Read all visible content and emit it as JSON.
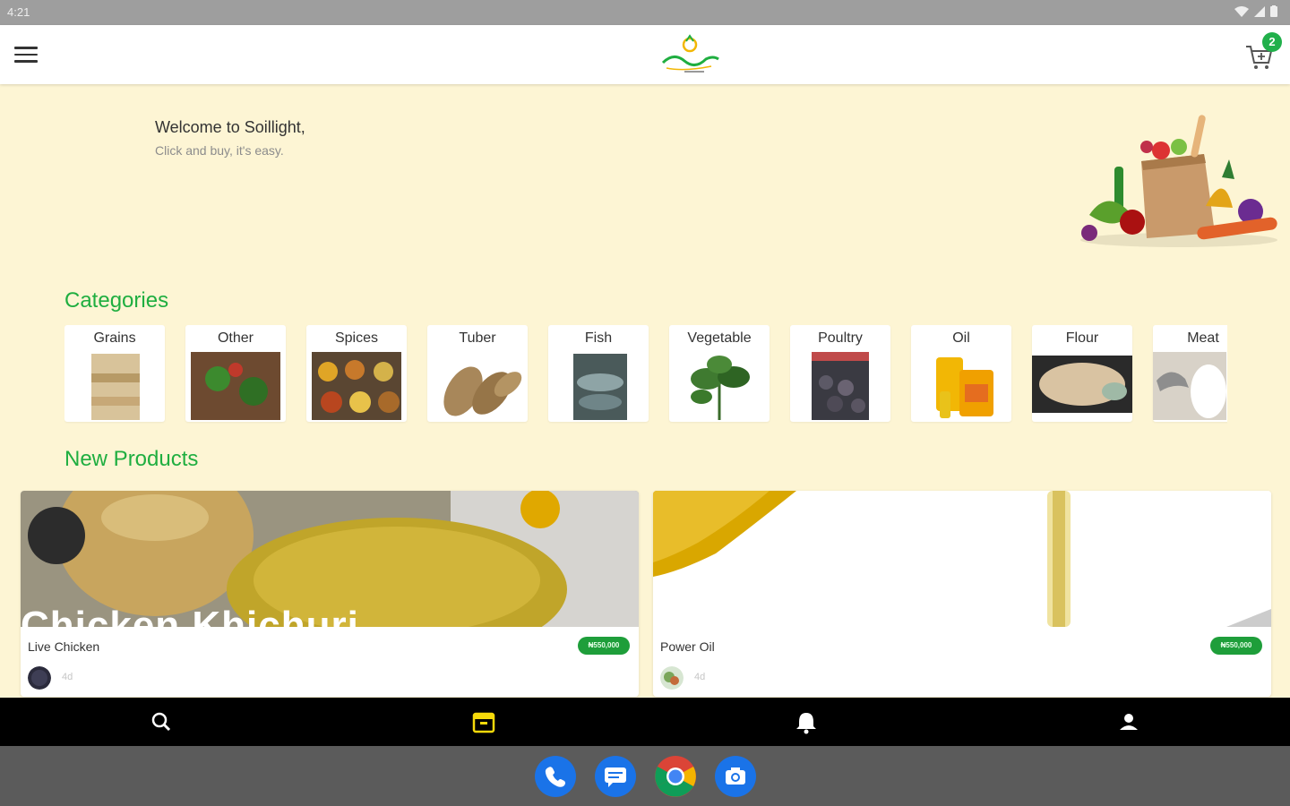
{
  "status": {
    "time": "4:21"
  },
  "app": {
    "cart_count": "2"
  },
  "welcome": {
    "title": "Welcome to Soillight,",
    "subtitle": "Click and buy, it's easy."
  },
  "sections": {
    "categories": "Categories",
    "new_products": "New Products"
  },
  "categories": [
    {
      "label": "Grains"
    },
    {
      "label": "Other"
    },
    {
      "label": "Spices"
    },
    {
      "label": "Tuber"
    },
    {
      "label": "Fish"
    },
    {
      "label": "Vegetable"
    },
    {
      "label": "Poultry"
    },
    {
      "label": "Oil"
    },
    {
      "label": "Flour"
    },
    {
      "label": "Meat"
    }
  ],
  "products": [
    {
      "name": "Live Chicken",
      "price": "₦550,000",
      "posted": "4d",
      "image_overlay": "Chicken Khichuri"
    },
    {
      "name": "Power Oil",
      "price": "₦550,000",
      "posted": "4d"
    }
  ],
  "colors": {
    "accent_green": "#1fae40",
    "background": "#fdf5d4",
    "nav_active": "#f5d90a"
  },
  "icons": {
    "menu": "hamburger-icon",
    "cart": "cart-icon",
    "search": "search-icon",
    "shop": "storefront-icon",
    "notifications": "bell-icon",
    "profile": "person-icon",
    "dock": [
      "phone-icon",
      "messages-icon",
      "chrome-icon",
      "camera-icon"
    ]
  }
}
